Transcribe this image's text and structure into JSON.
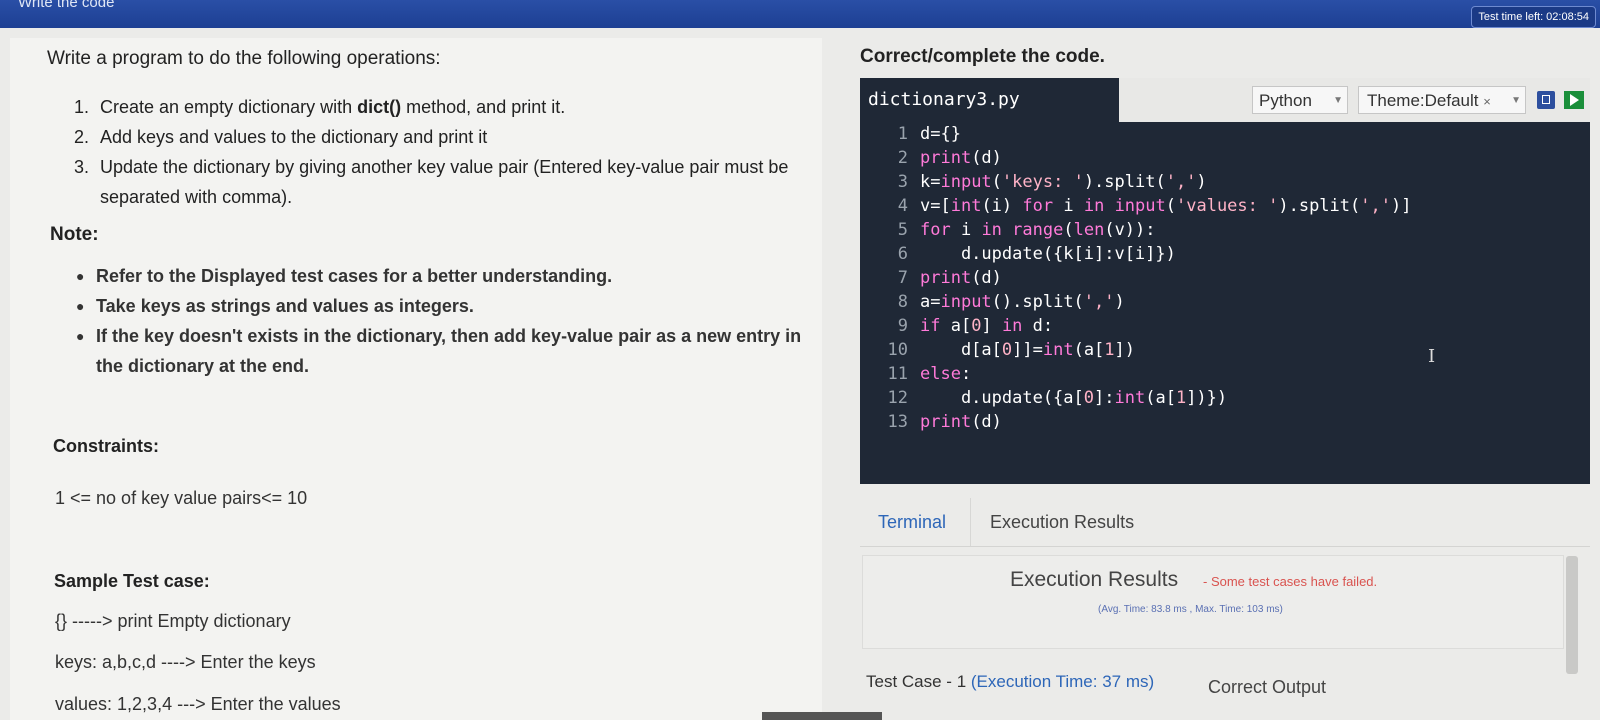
{
  "topbar": {
    "title": "Write the code",
    "timer": "Test time left: 02:08:54"
  },
  "problem": {
    "heading": "Write a program to do the following operations:",
    "steps": [
      {
        "num": "1.",
        "pre": "Create an empty dictionary with ",
        "bold": "dict()",
        "post": " method, and print it."
      },
      {
        "num": "2.",
        "text": "Add keys and values to the dictionary and print it"
      },
      {
        "num": "3.",
        "text": "Update the dictionary by giving another key value pair (Entered key-value pair must be separated with comma)."
      }
    ],
    "note_heading": "Note:",
    "notes": [
      "Refer to the Displayed test cases for a better understanding.",
      "Take keys as strings and values as integers.",
      "If the key doesn't exists in the dictionary, then add key-value pair as a new entry in the dictionary at the end."
    ],
    "constraints_heading": "Constraints:",
    "constraints": "1 <= no of key value pairs<= 10",
    "sample_heading": "Sample Test case:",
    "sample_lines": [
      "{} -----> print Empty dictionary",
      "keys: a,b,c,d ----> Enter the keys",
      "values: 1,2,3,4 ---> Enter the values"
    ]
  },
  "editor": {
    "heading": "Correct/complete the code.",
    "filename": "dictionary3.py",
    "language": "Python",
    "theme": "Theme:Default",
    "lines": [
      "1",
      "2",
      "3",
      "4",
      "5",
      "6",
      "7",
      "8",
      "9",
      "10",
      "11",
      "12",
      "13"
    ]
  },
  "results": {
    "tab_terminal": "Terminal",
    "tab_exec": "Execution Results",
    "title": "Execution Results",
    "status": "- Some test cases have failed.",
    "timing": "(Avg. Time: 83.8 ms , Max. Time: 103 ms)",
    "testcase_label": "Test Case - 1 ",
    "testcase_time": "(Execution Time: 37 ms)",
    "correct_output": "Correct Output"
  },
  "colors": {
    "accent": "#2d66b8",
    "editor_bg": "#1f2836",
    "fail": "#d9534f",
    "keyword": "#ff7ad9"
  }
}
